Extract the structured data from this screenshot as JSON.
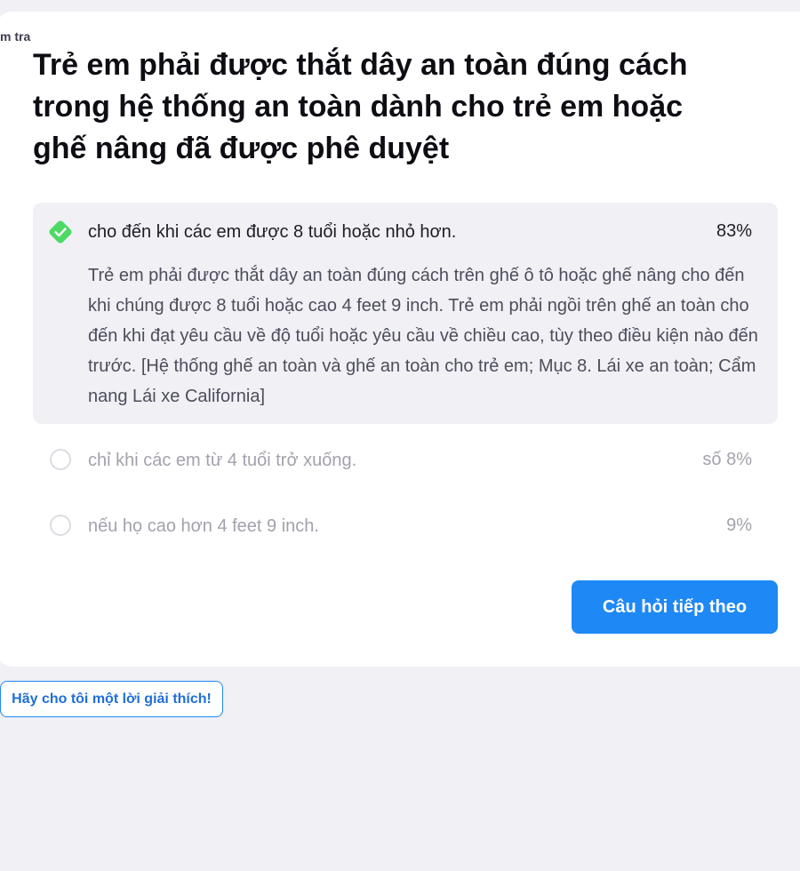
{
  "breadcrumb": "m tra",
  "question": "Trẻ em phải được thắt dây an toàn đúng cách trong hệ thống an toàn dành cho trẻ em hoặc ghế nâng đã được phê duyệt",
  "answers": [
    {
      "label": "cho đến khi các em được 8 tuổi hoặc nhỏ hơn.",
      "percent": "83%",
      "correct": true,
      "explanation": "Trẻ em phải được thắt dây an toàn đúng cách trên ghế ô tô hoặc ghế nâng cho đến khi chúng được 8 tuổi hoặc cao 4 feet 9 inch. Trẻ em phải ngồi trên ghế an toàn cho đến khi đạt yêu cầu về độ tuổi hoặc yêu cầu về chiều cao, tùy theo điều kiện nào đến trước. [Hệ thống ghế an toàn và ghế an toàn cho trẻ em; Mục 8. Lái xe an toàn; Cẩm nang Lái xe California]"
    },
    {
      "label": "chỉ khi các em từ 4 tuổi trở xuống.",
      "percent": "số 8%",
      "correct": false
    },
    {
      "label": "nếu họ cao hơn 4 feet 9 inch.",
      "percent": "9%",
      "correct": false
    }
  ],
  "buttons": {
    "next": "Câu hỏi tiếp theo",
    "explain": "Hãy cho tôi một lời giải thích!"
  },
  "colors": {
    "accent": "#1e88f5",
    "correct_green": "#4cd964",
    "card_bg": "#ffffff",
    "page_bg": "#f0f0f5"
  },
  "icons": {
    "correct": "check-icon",
    "unselected": "radio-icon"
  }
}
